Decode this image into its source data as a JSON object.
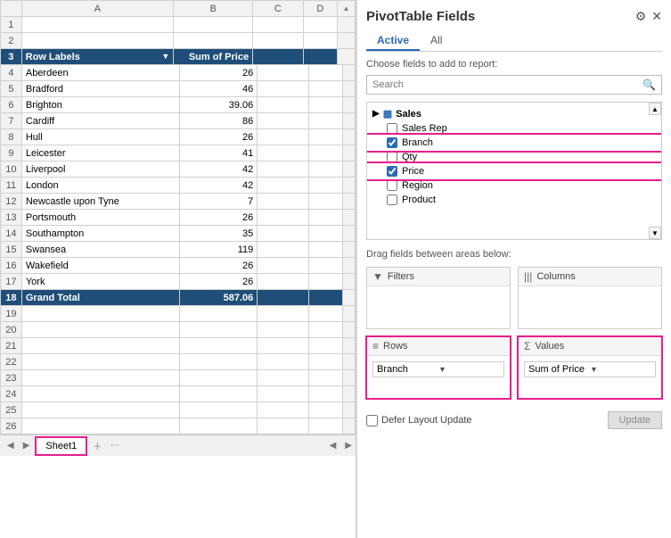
{
  "panel": {
    "title": "PivotTable Fields",
    "tabs": [
      "Active",
      "All"
    ],
    "active_tab": "Active",
    "choose_label": "Choose fields to add to report:",
    "search_placeholder": "Search",
    "gear_icon": "⚙",
    "close_icon": "✕",
    "settings_icon": "⚙",
    "field_sections": [
      {
        "name": "Sales",
        "icon": "▦",
        "items": [
          {
            "label": "Sales Rep",
            "checked": false
          },
          {
            "label": "Branch",
            "checked": true
          },
          {
            "label": "Qty",
            "checked": false
          },
          {
            "label": "Price",
            "checked": true
          },
          {
            "label": "Region",
            "checked": false
          },
          {
            "label": "Product",
            "checked": false
          }
        ]
      }
    ],
    "drag_label": "Drag fields between areas below:",
    "areas": [
      {
        "id": "filters",
        "icon": "▼",
        "label": "Filters",
        "items": []
      },
      {
        "id": "columns",
        "icon": "|||",
        "label": "Columns",
        "items": []
      },
      {
        "id": "rows",
        "icon": "≡",
        "label": "Rows",
        "items": [
          "Branch"
        ]
      },
      {
        "id": "values",
        "icon": "Σ",
        "label": "Values",
        "items": [
          "Sum of Price"
        ]
      }
    ],
    "defer_label": "Defer Layout Update",
    "update_btn": "Update"
  },
  "spreadsheet": {
    "columns": [
      "",
      "A",
      "B",
      "C",
      "D"
    ],
    "header_row": {
      "row": 3,
      "col_a": "Row Labels",
      "col_b": "Sum of Price"
    },
    "rows": [
      {
        "row": 4,
        "city": "Aberdeen",
        "value": "26"
      },
      {
        "row": 5,
        "city": "Bradford",
        "value": "46"
      },
      {
        "row": 6,
        "city": "Brighton",
        "value": "39.06"
      },
      {
        "row": 7,
        "city": "Cardiff",
        "value": "86"
      },
      {
        "row": 8,
        "city": "Hull",
        "value": "26"
      },
      {
        "row": 9,
        "city": "Leicester",
        "value": "41"
      },
      {
        "row": 10,
        "city": "Liverpool",
        "value": "42"
      },
      {
        "row": 11,
        "city": "London",
        "value": "42"
      },
      {
        "row": 12,
        "city": "Newcastle upon Tyne",
        "value": "7"
      },
      {
        "row": 13,
        "city": "Portsmouth",
        "value": "26"
      },
      {
        "row": 14,
        "city": "Southampton",
        "value": "35"
      },
      {
        "row": 15,
        "city": "Swansea",
        "value": "119"
      },
      {
        "row": 16,
        "city": "Wakefield",
        "value": "26"
      },
      {
        "row": 17,
        "city": "York",
        "value": "26"
      },
      {
        "row": 18,
        "city": "Grand Total",
        "value": "587.06",
        "is_total": true
      }
    ],
    "empty_rows": [
      19,
      20,
      21,
      22,
      23,
      24,
      25,
      26
    ],
    "tab_name": "Sheet1"
  }
}
